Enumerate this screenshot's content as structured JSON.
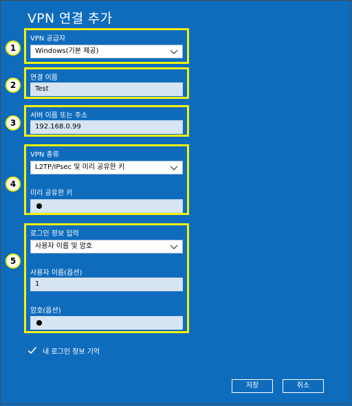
{
  "window": {
    "title": "VPN 연결 추가"
  },
  "badges": [
    "1",
    "2",
    "3",
    "4",
    "5"
  ],
  "provider": {
    "label": "VPN 공급자",
    "value": "Windows(기본 제공)"
  },
  "connection_name": {
    "label": "연결 이름",
    "value": "Test"
  },
  "server": {
    "label": "서버 이름 또는 주소",
    "value": "192.168.0.99"
  },
  "vpn_type": {
    "label": "VPN 종류",
    "value": "L2TP/IPsec 및 미리 공유한 키"
  },
  "preshared_key": {
    "label": "미리 공유한 키"
  },
  "signin": {
    "label": "로그인 정보 입력",
    "value": "사용자 이름 및 암호",
    "username_label": "사용자 이름(옵션)",
    "username_value": "1",
    "password_label": "암호(옵션)"
  },
  "remember": {
    "label": "내 로그인 정보 기억",
    "checked": true
  },
  "buttons": {
    "save": "저장",
    "cancel": "취소"
  },
  "colors": {
    "background": "#0f6cbd",
    "highlight": "#f2f20b"
  }
}
